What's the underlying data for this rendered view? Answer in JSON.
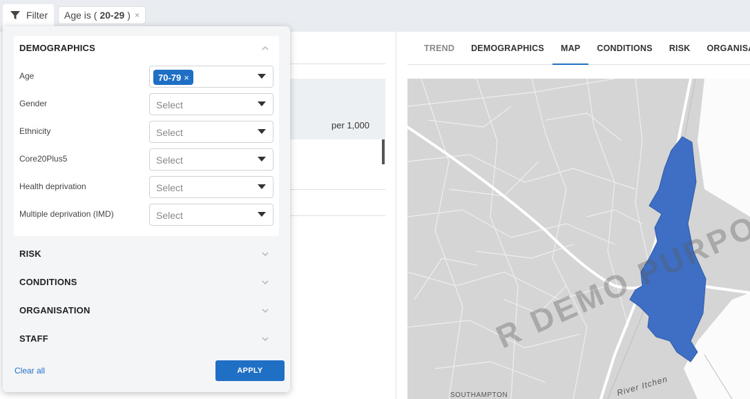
{
  "topbar": {
    "filter_label": "Filter",
    "chip_prefix": "Age is (",
    "chip_value": "20-29",
    "chip_suffix": ")",
    "chip_close": "×"
  },
  "background": {
    "per_label": "per 1,000"
  },
  "tabs": [
    "TREND",
    "DEMOGRAPHICS",
    "MAP",
    "CONDITIONS",
    "RISK",
    "ORGANISATION"
  ],
  "active_tab": "MAP",
  "map": {
    "place_label": "SOUTHAMPTON",
    "river_label": "River Itchen",
    "watermark": "R DEMO PURPO"
  },
  "filter_panel": {
    "demographics_title": "DEMOGRAPHICS",
    "fields": [
      {
        "label": "Age",
        "tag": "70-79",
        "tag_close": "×",
        "placeholder": ""
      },
      {
        "label": "Gender",
        "placeholder": "Select"
      },
      {
        "label": "Ethnicity",
        "placeholder": "Select"
      },
      {
        "label": "Core20Plus5",
        "placeholder": "Select"
      },
      {
        "label": "Health deprivation",
        "placeholder": "Select"
      },
      {
        "label": "Multiple deprivation (IMD)",
        "placeholder": "Select"
      }
    ],
    "sections": [
      "RISK",
      "CONDITIONS",
      "ORGANISATION",
      "STAFF"
    ],
    "clear_all": "Clear all",
    "apply": "APPLY"
  },
  "colors": {
    "accent": "#1f6fc5",
    "map_highlight": "#3f6fc4",
    "map_base": "#d5d5d5",
    "road": "#ffffff"
  }
}
